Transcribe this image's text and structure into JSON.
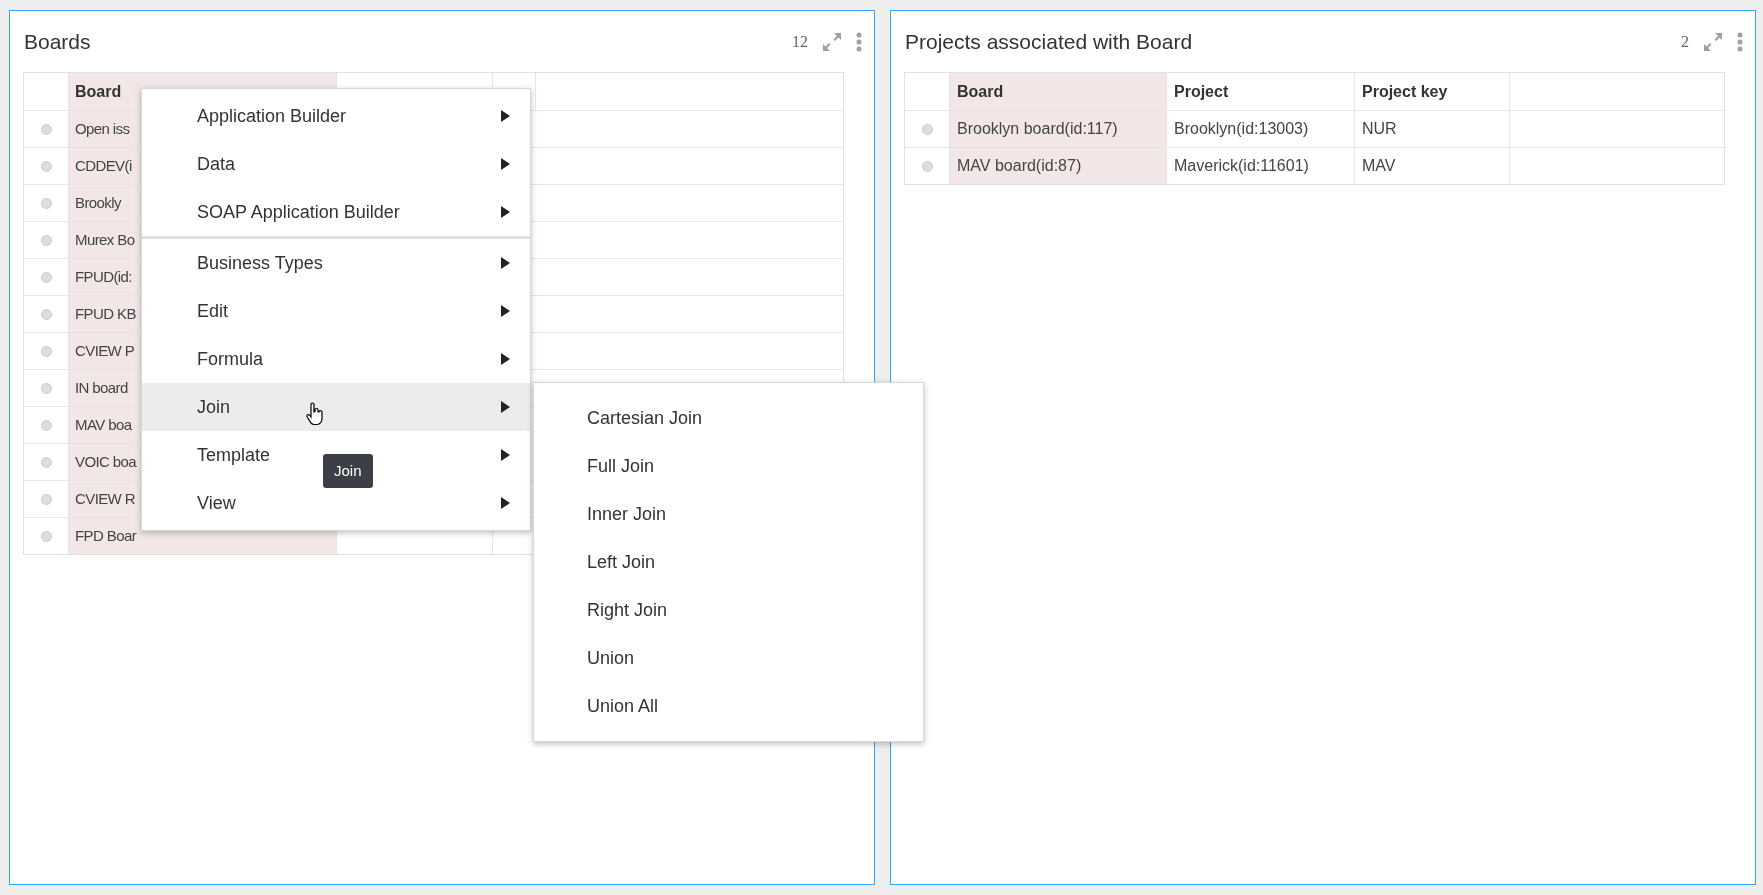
{
  "panels": [
    {
      "title": "Boards",
      "count": "12",
      "columns": [
        {
          "label": "Board",
          "highlight": true
        }
      ],
      "rows": [
        {
          "selected": false,
          "cells": [
            "Open iss"
          ]
        },
        {
          "selected": false,
          "cells": [
            "CDDEV(i"
          ]
        },
        {
          "selected": false,
          "cells": [
            "Brookly"
          ]
        },
        {
          "selected": false,
          "cells": [
            "Murex Bo"
          ]
        },
        {
          "selected": false,
          "cells": [
            "FPUD(id:"
          ]
        },
        {
          "selected": false,
          "cells": [
            "FPUD KB"
          ]
        },
        {
          "selected": false,
          "cells": [
            "CVIEW P"
          ]
        },
        {
          "selected": false,
          "cells": [
            "IN board"
          ]
        },
        {
          "selected": false,
          "cells": [
            "MAV boa"
          ]
        },
        {
          "selected": false,
          "cells": [
            "VOIC boa"
          ]
        },
        {
          "selected": false,
          "cells": [
            "CVIEW R"
          ]
        },
        {
          "selected": false,
          "cells": [
            "FPD Boar"
          ]
        }
      ]
    },
    {
      "title": "Projects associated with Board",
      "count": "2",
      "columns": [
        {
          "label": "Board",
          "highlight": true
        },
        {
          "label": "Project",
          "highlight": false
        },
        {
          "label": "Project key",
          "highlight": false
        }
      ],
      "rows": [
        {
          "selected": false,
          "cells": [
            "Brooklyn board(id:117)",
            "Brooklyn(id:13003)",
            "NUR"
          ]
        },
        {
          "selected": false,
          "cells": [
            "MAV board(id:87)",
            "Maverick(id:11601)",
            "MAV"
          ]
        }
      ]
    }
  ],
  "context_menu": {
    "sections": [
      [
        {
          "label": "Application Builder",
          "selected": false
        },
        {
          "label": "Data",
          "selected": false
        },
        {
          "label": "SOAP Application Builder",
          "selected": false
        }
      ],
      [
        {
          "label": "Business Types",
          "selected": false
        },
        {
          "label": "Edit",
          "selected": false
        },
        {
          "label": "Formula",
          "selected": false
        },
        {
          "label": "Join",
          "selected": true
        },
        {
          "label": "Template",
          "selected": false
        },
        {
          "label": "View",
          "selected": false
        }
      ]
    ],
    "submenu": [
      "Cartesian Join",
      "Full Join",
      "Inner Join",
      "Left Join",
      "Right Join",
      "Union",
      "Union All"
    ],
    "tooltip": "Join"
  }
}
